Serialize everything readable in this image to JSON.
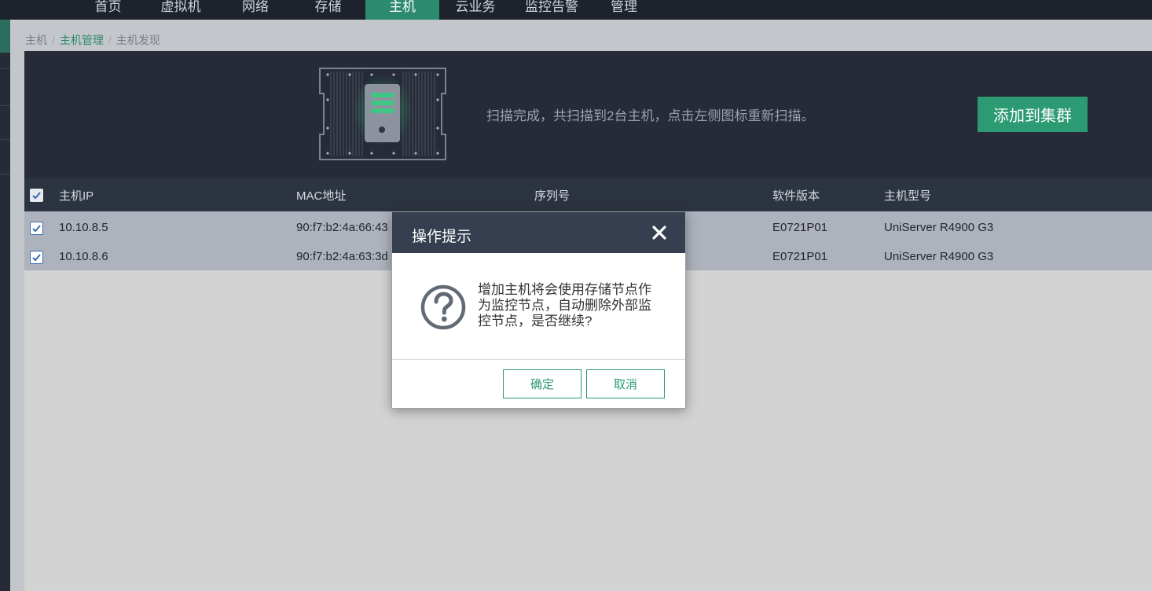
{
  "nav": {
    "items": [
      {
        "label": "首页"
      },
      {
        "label": "虚拟机"
      },
      {
        "label": "网络"
      },
      {
        "label": "存储"
      },
      {
        "label": "主机",
        "active": true
      },
      {
        "label": "云业务"
      },
      {
        "label": "监控告警"
      },
      {
        "label": "管理"
      }
    ]
  },
  "breadcrumb": {
    "items": [
      "主机",
      "主机管理",
      "主机发现"
    ],
    "separator": "/"
  },
  "banner": {
    "scan_message": "扫描完成，共扫描到2台主机，点击左侧图标重新扫描。",
    "add_button_label": "添加到集群",
    "scan_icon": "server-scan-icon"
  },
  "table": {
    "columns": [
      "主机IP",
      "MAC地址",
      "序列号",
      "软件版本",
      "主机型号"
    ],
    "rows": [
      {
        "ip": "10.10.8.5",
        "mac": "90:f7:b2:4a:66:43",
        "serial": "",
        "version": "E0721P01",
        "model": "UniServer R4900 G3",
        "checked": true
      },
      {
        "ip": "10.10.8.6",
        "mac": "90:f7:b2:4a:63:3d",
        "serial": "",
        "version": "E0721P01",
        "model": "UniServer R4900 G3",
        "checked": true
      }
    ]
  },
  "modal": {
    "title": "操作提示",
    "message": "增加主机将会使用存储节点作为监控节点，自动删除外部监控节点，是否继续?",
    "icon": "question-circle-icon",
    "confirm_label": "确定",
    "cancel_label": "取消"
  },
  "colors": {
    "accent": "#2c9a72",
    "nav_bg": "#1d222c",
    "banner_bg": "#262b37",
    "modal_header": "#353f4f"
  }
}
